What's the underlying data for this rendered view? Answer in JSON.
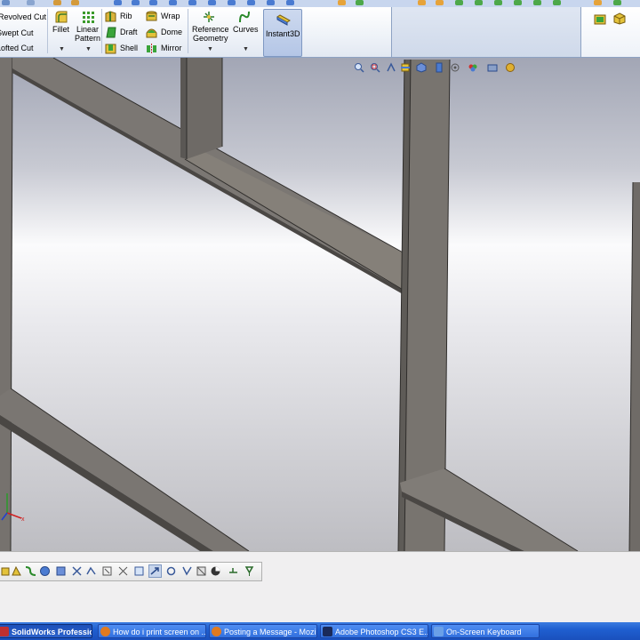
{
  "ribbon": {
    "revolved_cut": "Revolved Cut",
    "swept_cut": "Swept Cut",
    "lofted_cut": "Lofted Cut",
    "fillet": "Fillet",
    "linear_pattern_1": "Linear",
    "linear_pattern_2": "Pattern",
    "rib": "Rib",
    "draft": "Draft",
    "shell": "Shell",
    "wrap": "Wrap",
    "dome": "Dome",
    "mirror": "Mirror",
    "reference_geometry_1": "Reference",
    "reference_geometry_2": "Geometry",
    "curves": "Curves",
    "instant3d": "Instant3D"
  },
  "taskbar": {
    "items": [
      {
        "label": "SolidWorks Professio...",
        "active": true
      },
      {
        "label": "How do i print screen on ..."
      },
      {
        "label": "Posting a Message - Mozi..."
      },
      {
        "label": "Adobe Photoshop CS3 E..."
      },
      {
        "label": "On-Screen Keyboard"
      }
    ]
  },
  "icons": {
    "fillet": "fillet-icon",
    "linear_pattern": "linear-pattern-icon",
    "rib": "rib-icon",
    "draft": "draft-icon",
    "shell": "shell-icon",
    "wrap": "wrap-icon",
    "dome": "dome-icon",
    "mirror": "mirror-icon",
    "reference_geometry": "reference-geometry-icon",
    "curves": "curves-icon",
    "instant3d": "instant3d-icon"
  },
  "colors": {
    "ribbon_bg": "#eef2f8",
    "viewport_top": "#9ea3b3",
    "beam_face": "#7a7672",
    "beam_dark": "#4a4744",
    "taskbar": "#245edb"
  }
}
